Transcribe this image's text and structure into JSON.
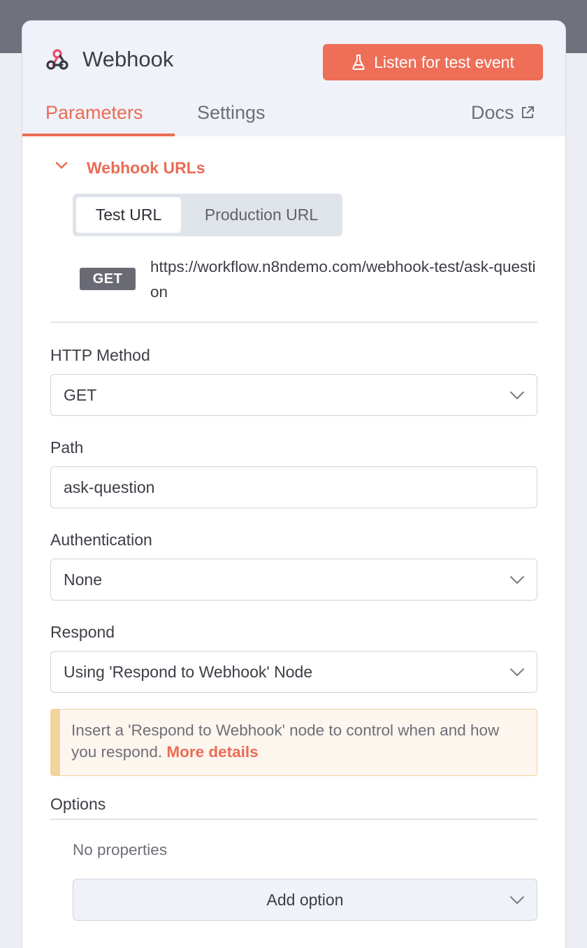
{
  "node": {
    "title": "Webhook",
    "listen_button": "Listen for test event"
  },
  "tabs": {
    "parameters": "Parameters",
    "settings": "Settings",
    "docs": "Docs"
  },
  "webhook_urls": {
    "section_title": "Webhook URLs",
    "segments": [
      "Test URL",
      "Production URL"
    ],
    "selected_segment": "Test URL",
    "method_badge": "GET",
    "url": "https://workflow.n8ndemo.com/webhook-test/ask-question"
  },
  "fields": {
    "http_method": {
      "label": "HTTP Method",
      "value": "GET"
    },
    "path": {
      "label": "Path",
      "value": "ask-question"
    },
    "authentication": {
      "label": "Authentication",
      "value": "None"
    },
    "respond": {
      "label": "Respond",
      "value": "Using 'Respond to Webhook' Node"
    }
  },
  "notice": {
    "text": "Insert a 'Respond to Webhook' node to control when and how you respond. ",
    "link": "More details"
  },
  "options": {
    "label": "Options",
    "empty_text": "No properties",
    "add_button": "Add option"
  },
  "colors": {
    "accent": "#ea6c55",
    "listen_button_bg": "#ee6e58",
    "notice_bg": "#fdf6ee",
    "notice_border": "#f1d49c",
    "badge_bg": "#696a73"
  },
  "icons": {
    "node": "webhook-icon",
    "listen": "flask-icon",
    "docs": "external-link-icon",
    "collapse": "chevron-down-icon",
    "dropdown": "chevron-down-icon"
  }
}
